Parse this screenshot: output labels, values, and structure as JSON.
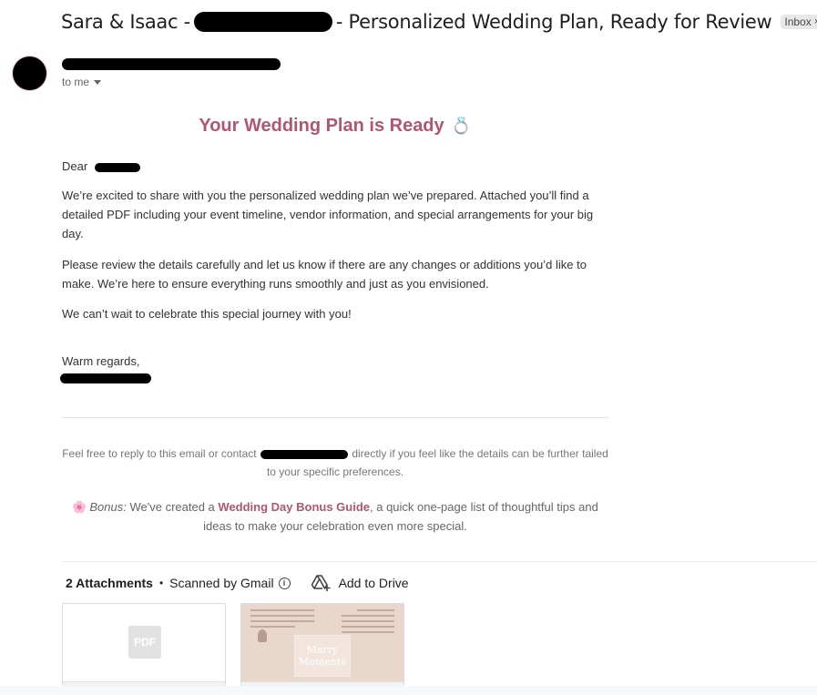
{
  "email": {
    "subject_start": "Sara & Isaac -",
    "subject_end": "- Personalized Wedding Plan, Ready for Review",
    "label": "Inbox",
    "label_close": "×",
    "recipient": "to me"
  },
  "body": {
    "title": "Your Wedding Plan is Ready",
    "title_icon": "💍",
    "greeting": "Dear",
    "paragraph_1": "We’re excited to share with you the personalized wedding plan we’ve prepared. Attached you’ll find a detailed PDF including your event timeline, vendor information, and special arrangements for your big day.",
    "paragraph_2": "Please review the details carefully and let us know if there are any changes or additions you’d like to make. We’re here to ensure everything runs smoothly and just as you envisioned.",
    "paragraph_3": "We can’t wait to celebrate this special journey with you!",
    "closing": "Warm regards,"
  },
  "footer": {
    "contact_before": "Feel free to reply to this email or contact",
    "contact_after": "directly if you feel like the details can be further tailed to your specific preferences.",
    "bonus_icon": "🌸",
    "bonus_label": "Bonus:",
    "bonus_before": "We've created a",
    "bonus_link": "Wedding Day Bonus Guide",
    "bonus_after": ", a quick one-page list of thoughtful tips and ideas to make your celebration even more special."
  },
  "attachments": {
    "count_label": "2 Attachments",
    "separator": "•",
    "scanned_label": "Scanned by Gmail",
    "info_symbol": "i",
    "drive_label": "Add to Drive",
    "items": [
      {
        "type_badge": "PDF"
      },
      {
        "thumb_line_1": "Marry",
        "thumb_line_2": "Moments"
      }
    ]
  },
  "colors": {
    "accent": "#b0566f",
    "redaction": "#000000"
  }
}
